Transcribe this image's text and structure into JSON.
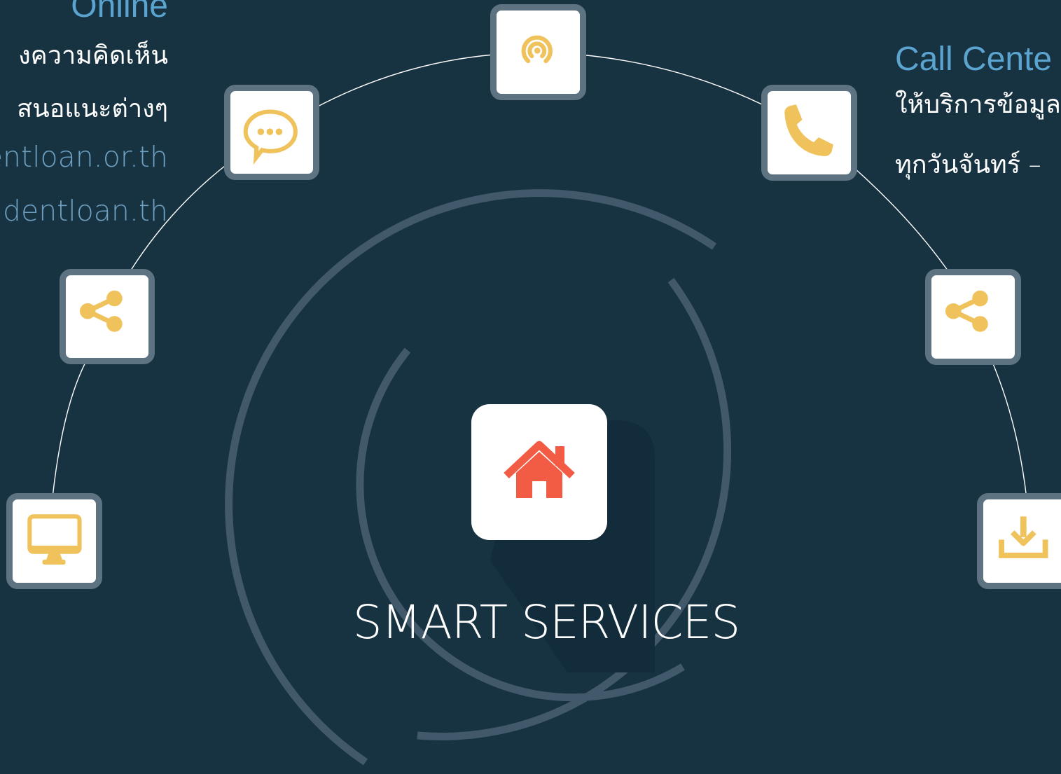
{
  "center": {
    "title": "SMART SERVICES",
    "icon": "home-icon"
  },
  "online_block": {
    "heading": "Online",
    "lines": [
      "งความคิดเห็น",
      "สนอแนะต่างๆ"
    ],
    "links": [
      "entloan.or.th",
      "udentloan.th"
    ]
  },
  "callcenter_block": {
    "heading": "Call Cente",
    "lines": [
      "ให้บริการข้อมูล",
      "ทุกวันจันทร์ –"
    ]
  },
  "orbit_icons": [
    {
      "name": "broadcast-icon"
    },
    {
      "name": "chat-bubble-icon"
    },
    {
      "name": "phone-icon"
    },
    {
      "name": "share-icon"
    },
    {
      "name": "monitor-icon"
    },
    {
      "name": "share-icon"
    },
    {
      "name": "download-icon"
    }
  ],
  "colors": {
    "background": "#173241",
    "accent_yellow": "#efc25b",
    "home_red": "#f25c45",
    "heading_blue": "#5aa4cf",
    "ring_gray": "#41596a"
  }
}
